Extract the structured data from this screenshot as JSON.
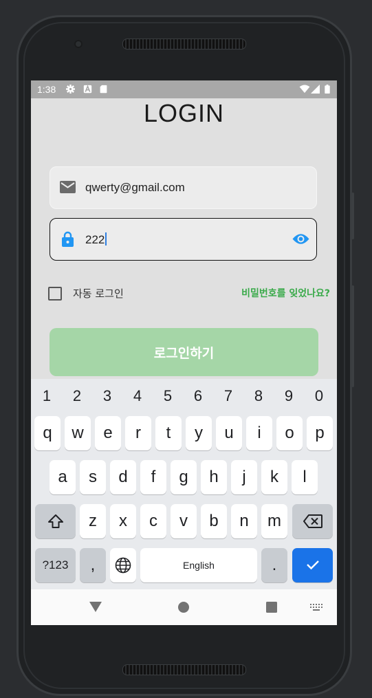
{
  "status": {
    "time": "1:38"
  },
  "login": {
    "title": "LOGIN",
    "email_value": "qwerty@gmail.com",
    "password_value": "222",
    "auto_login_label": "자동 로그인",
    "auto_login_checked": false,
    "forgot_password_label": "비밀번호를 잊었나요?",
    "submit_label": "로그인하기"
  },
  "keyboard": {
    "numbers": [
      "1",
      "2",
      "3",
      "4",
      "5",
      "6",
      "7",
      "8",
      "9",
      "0"
    ],
    "row1": [
      "q",
      "w",
      "e",
      "r",
      "t",
      "y",
      "u",
      "i",
      "o",
      "p"
    ],
    "row2": [
      "a",
      "s",
      "d",
      "f",
      "g",
      "h",
      "j",
      "k",
      "l"
    ],
    "row3": [
      "z",
      "x",
      "c",
      "v",
      "b",
      "n",
      "m"
    ],
    "symbols_label": "?123",
    "comma_label": ",",
    "space_label": "English",
    "period_label": "."
  },
  "colors": {
    "accent_green": "#3aaa4a",
    "button_green": "#a5d6a7",
    "keyboard_action_blue": "#1a73e8",
    "visibility_icon_blue": "#2196f3"
  },
  "icons": [
    "email-icon",
    "lock-icon",
    "visibility-icon",
    "shift-icon",
    "backspace-icon",
    "globe-icon",
    "check-icon",
    "back-nav-icon",
    "home-nav-icon",
    "recents-nav-icon",
    "keyboard-switch-icon",
    "settings-icon",
    "font-icon",
    "sd-card-icon",
    "wifi-icon",
    "signal-icon",
    "battery-icon"
  ]
}
